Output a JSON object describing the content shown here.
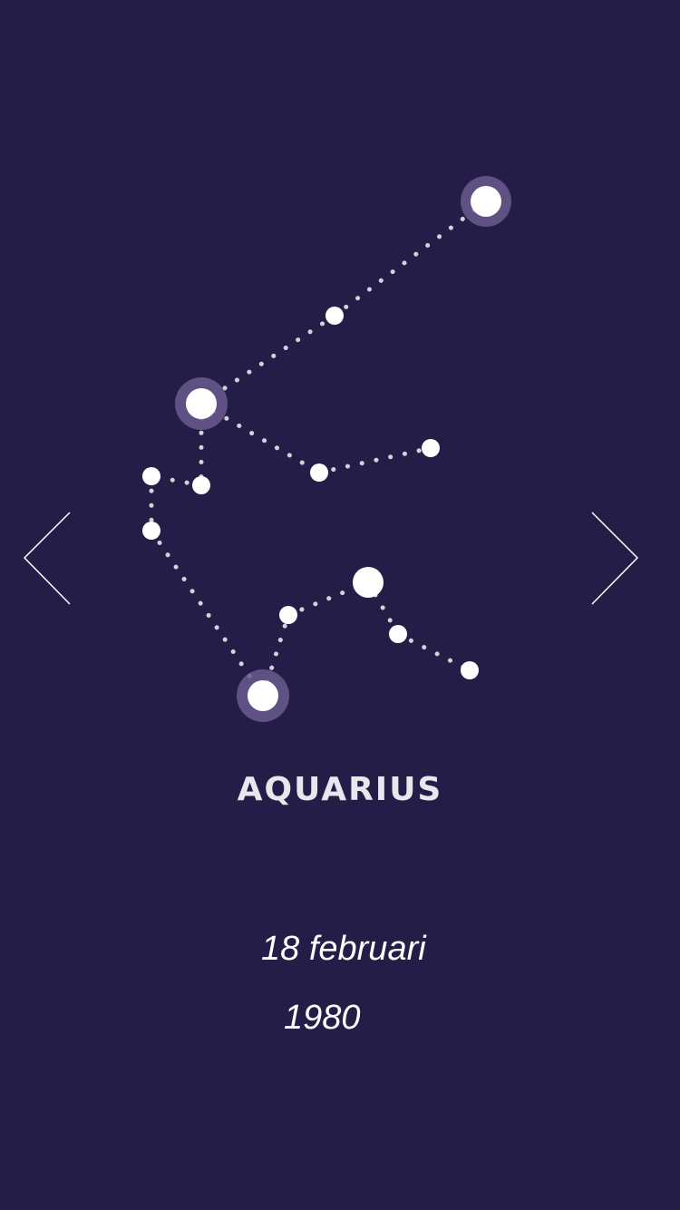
{
  "navigation": {
    "prev_icon": "chevron-left-icon",
    "next_icon": "chevron-right-icon"
  },
  "sign": {
    "name": "AQUARIUS",
    "constellation_icon": "aquarius-constellation-icon"
  },
  "birth": {
    "day_month": "18 februari",
    "year": "1980"
  },
  "colors": {
    "background": "#231d47",
    "star": "#ffffff",
    "star_halo": "#6a5a8e",
    "text": "#ffffff"
  }
}
